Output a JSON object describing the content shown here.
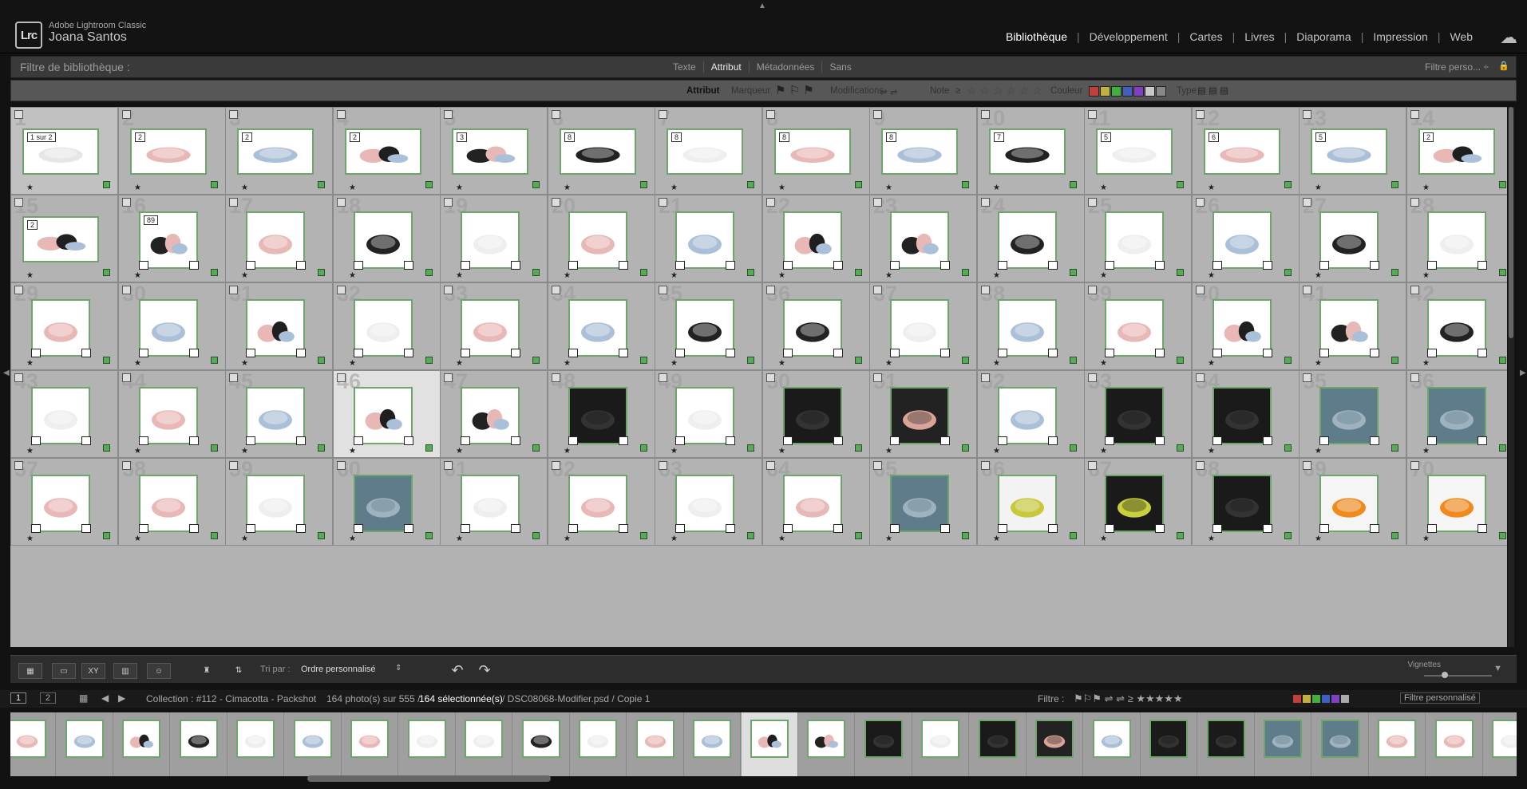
{
  "app": {
    "name": "Adobe Lightroom Classic",
    "user": "Joana Santos",
    "logo": "Lrc"
  },
  "modules": [
    "Bibliothèque",
    "Développement",
    "Cartes",
    "Livres",
    "Diaporama",
    "Impression",
    "Web"
  ],
  "active_module": "Bibliothèque",
  "filter_bar": {
    "title": "Filtre de bibliothèque :",
    "tabs": [
      "Texte",
      "Attribut",
      "Métadonnées",
      "Sans"
    ],
    "active_tab": "Attribut",
    "preset": "Filtre perso... ÷"
  },
  "attribute_bar": {
    "label": "Attribut",
    "flag_label": "Marqueur",
    "edits_label": "Modifications",
    "rating_label": "Note",
    "rating_op": "≥",
    "color_label": "Couleur",
    "type_label": "Type",
    "colors": [
      "#c04040",
      "#c0b040",
      "#40b040",
      "#4060c0",
      "#8040c0",
      "#c8c8c8",
      "#888888"
    ]
  },
  "grid": {
    "rows": [
      {
        "cells": [
          {
            "n": "1",
            "badge": "1 sur 2",
            "wide": true,
            "sel": true,
            "img": "white-stack"
          },
          {
            "n": "2",
            "badge": "2",
            "wide": true,
            "img": "pink"
          },
          {
            "n": "3",
            "badge": "2",
            "wide": true,
            "img": "blue"
          },
          {
            "n": "4",
            "badge": "2",
            "wide": true,
            "img": "mix"
          },
          {
            "n": "5",
            "badge": "3",
            "wide": true,
            "img": "mix2"
          },
          {
            "n": "6",
            "badge": "8",
            "wide": true,
            "img": "black"
          },
          {
            "n": "7",
            "badge": "8",
            "wide": true,
            "img": "white"
          },
          {
            "n": "8",
            "badge": "8",
            "wide": true,
            "img": "pink"
          },
          {
            "n": "9",
            "badge": "8",
            "wide": true,
            "img": "blue"
          },
          {
            "n": "10",
            "badge": "7",
            "wide": true,
            "img": "black"
          },
          {
            "n": "11",
            "badge": "5",
            "wide": true,
            "img": "white"
          },
          {
            "n": "12",
            "badge": "6",
            "wide": true,
            "img": "pink"
          },
          {
            "n": "13",
            "badge": "5",
            "wide": true,
            "img": "blue"
          },
          {
            "n": "14",
            "badge": "2",
            "wide": true,
            "img": "mix"
          }
        ]
      },
      {
        "cells": [
          {
            "n": "15",
            "badge": "2",
            "wide": true,
            "img": "mix"
          },
          {
            "n": "16",
            "badge": "89",
            "img": "mix2"
          },
          {
            "n": "17",
            "img": "pink"
          },
          {
            "n": "18",
            "img": "black"
          },
          {
            "n": "19",
            "img": "white"
          },
          {
            "n": "20",
            "img": "pink"
          },
          {
            "n": "21",
            "img": "blue"
          },
          {
            "n": "22",
            "img": "mix"
          },
          {
            "n": "23",
            "img": "mix2"
          },
          {
            "n": "24",
            "img": "black"
          },
          {
            "n": "25",
            "img": "white"
          },
          {
            "n": "26",
            "img": "blue"
          },
          {
            "n": "27",
            "img": "black"
          },
          {
            "n": "28",
            "img": "white"
          }
        ]
      },
      {
        "cells": [
          {
            "n": "29",
            "img": "pink"
          },
          {
            "n": "30",
            "img": "blue"
          },
          {
            "n": "31",
            "img": "mix"
          },
          {
            "n": "32",
            "img": "white"
          },
          {
            "n": "33",
            "img": "pink"
          },
          {
            "n": "34",
            "img": "blue"
          },
          {
            "n": "35",
            "img": "black"
          },
          {
            "n": "36",
            "img": "black"
          },
          {
            "n": "37",
            "img": "white"
          },
          {
            "n": "38",
            "img": "blue"
          },
          {
            "n": "39",
            "img": "pink"
          },
          {
            "n": "40",
            "img": "mix"
          },
          {
            "n": "41",
            "img": "mix2"
          },
          {
            "n": "42",
            "img": "black"
          }
        ]
      },
      {
        "cells": [
          {
            "n": "43",
            "img": "white"
          },
          {
            "n": "44",
            "img": "pink"
          },
          {
            "n": "45",
            "img": "blue"
          },
          {
            "n": "46",
            "img": "mix",
            "cur": true
          },
          {
            "n": "47",
            "img": "mix2"
          },
          {
            "n": "48",
            "img": "dark"
          },
          {
            "n": "49",
            "img": "white"
          },
          {
            "n": "50",
            "img": "dark"
          },
          {
            "n": "51",
            "img": "pinkdark"
          },
          {
            "n": "52",
            "img": "blue"
          },
          {
            "n": "53",
            "img": "dark"
          },
          {
            "n": "54",
            "img": "dark"
          },
          {
            "n": "55",
            "img": "slate"
          },
          {
            "n": "56",
            "img": "slate"
          }
        ]
      },
      {
        "cells": [
          {
            "n": "57",
            "img": "pink"
          },
          {
            "n": "58",
            "img": "pink"
          },
          {
            "n": "59",
            "img": "white"
          },
          {
            "n": "60",
            "img": "slate"
          },
          {
            "n": "61",
            "img": "white"
          },
          {
            "n": "62",
            "img": "pink"
          },
          {
            "n": "63",
            "img": "white"
          },
          {
            "n": "64",
            "img": "pink"
          },
          {
            "n": "65",
            "img": "slate"
          },
          {
            "n": "66",
            "img": "lemon"
          },
          {
            "n": "67",
            "img": "darklemon"
          },
          {
            "n": "68",
            "img": "dark"
          },
          {
            "n": "69",
            "img": "orange"
          },
          {
            "n": "70",
            "img": "orange"
          }
        ]
      }
    ]
  },
  "toolbar": {
    "sort_label": "Tri par :",
    "sort_value": "Ordre personnalisé",
    "thumb_label": "Vignettes"
  },
  "status": {
    "collection": "Collection : #112 - Cimacotta - Packshot",
    "count_prefix": "164 photo(s) sur 555 /",
    "selected": "164 sélectionnée(s)",
    "file": "/ DSC08068-Modifier.psd / Copie 1",
    "filter_label": "Filtre :",
    "filter_preset": "Filtre personnalisé",
    "screen1": "1",
    "screen2": "2"
  },
  "filmstrip": [
    "pink",
    "blue",
    "mix",
    "black",
    "white",
    "blue",
    "pink",
    "white",
    "white",
    "black",
    "white",
    "pink",
    "blue",
    "mix",
    "mix2",
    "dark",
    "white",
    "dark",
    "pinkdark",
    "blue",
    "dark",
    "dark",
    "slate",
    "slate",
    "pink",
    "pink",
    "white"
  ]
}
